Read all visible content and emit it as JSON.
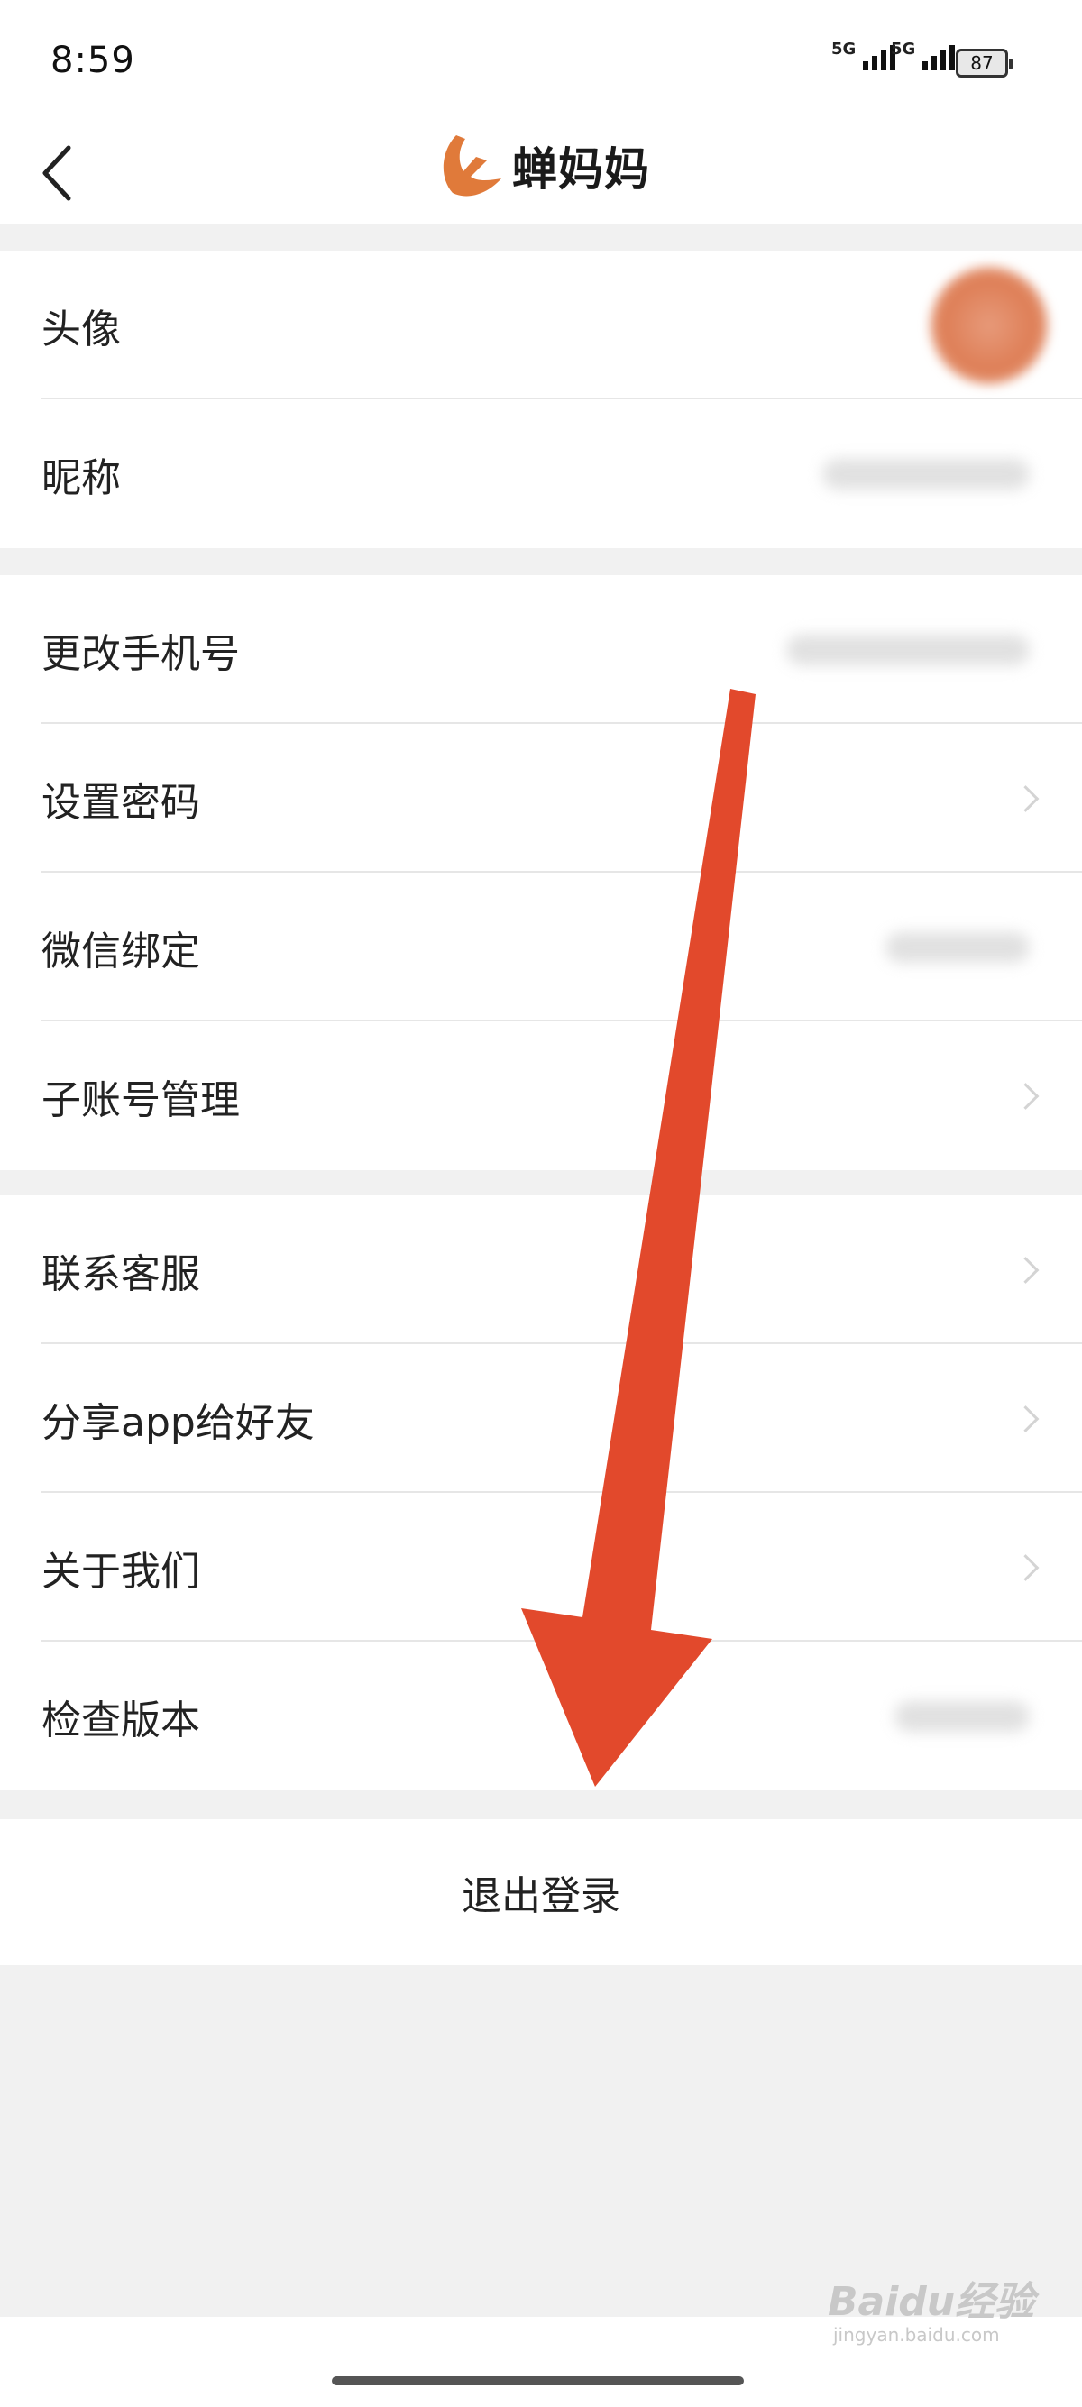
{
  "status_bar": {
    "time": "8:59",
    "network_1": "5G",
    "network_2": "5G",
    "battery": "87"
  },
  "header": {
    "back_icon": "chevron-left-icon",
    "app_name": "蝉妈妈",
    "brand_color": "#e07a3a"
  },
  "profile_group": {
    "items": [
      {
        "label": "头像"
      },
      {
        "label": "昵称"
      }
    ]
  },
  "account_group": {
    "items": [
      {
        "label": "更改手机号"
      },
      {
        "label": "设置密码"
      },
      {
        "label": "微信绑定"
      },
      {
        "label": "子账号管理"
      }
    ]
  },
  "support_group": {
    "items": [
      {
        "label": "联系客服"
      },
      {
        "label": "分享app给好友"
      },
      {
        "label": "关于我们"
      },
      {
        "label": "检查版本"
      }
    ]
  },
  "logout": {
    "label": "退出登录"
  },
  "annotation": {
    "arrow_color": "#e2492c"
  },
  "watermark": {
    "main": "Baidu经验",
    "sub": "jingyan.baidu.com"
  }
}
